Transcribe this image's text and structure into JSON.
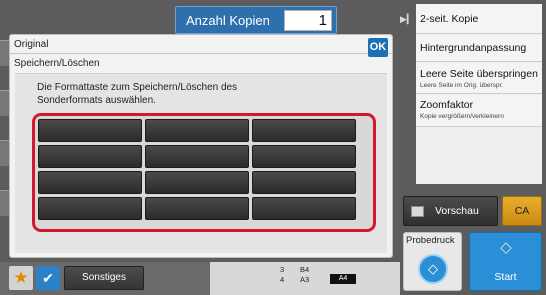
{
  "copies": {
    "label": "Anzahl Kopien",
    "value": "1"
  },
  "right_panel": {
    "items": [
      {
        "title": "2-seit. Kopie",
        "subtitle": ""
      },
      {
        "title": "Hintergrundanpassung",
        "subtitle": ""
      },
      {
        "title": "Leere Seite überspringen",
        "subtitle": "Leere Seite im Orig. überspr."
      },
      {
        "title": "Zoomfaktor",
        "subtitle": "Kopie vergrößern/verkleinern"
      }
    ]
  },
  "dialog": {
    "title": "Original",
    "subtitle": "Speichern/Löschen",
    "ok_label": "OK",
    "instruction": "Die Formattaste zum Speichern/Löschen des Sonderformats auswählen.",
    "format_keys": [
      "",
      "",
      "",
      "",
      "",
      "",
      "",
      "",
      "",
      "",
      "",
      ""
    ]
  },
  "bottom_bar": {
    "star_icon": "★",
    "check_icon": "✔",
    "sonstiges_label": "Sonstiges",
    "paper": {
      "tray3": "3",
      "tray3_size": "B4",
      "tray4": "4",
      "tray4_size": "A3",
      "selected": "A4"
    }
  },
  "controls": {
    "preview_label": "Vorschau",
    "ca_label": "CA",
    "proof_label": "Probedruck",
    "proof_icon": "◇",
    "start_label": "Start",
    "start_icon": "◇"
  },
  "colors": {
    "accent": "#2a8fd6",
    "highlight": "#d0182f",
    "ca": "#e9ad2c"
  }
}
